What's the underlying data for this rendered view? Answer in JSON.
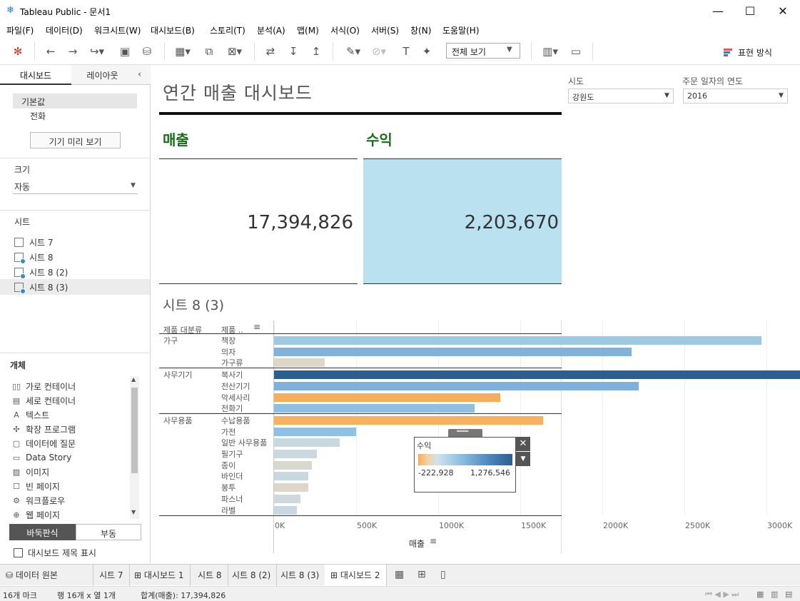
{
  "window": {
    "title": "Tableau Public - 문서1",
    "minimize": "—",
    "maximize": "☐",
    "close": "✕"
  },
  "menu": [
    "파일(F)",
    "데이터(D)",
    "워크시트(W)",
    "대시보드(B)",
    "스토리(T)",
    "분석(A)",
    "맵(M)",
    "서식(O)",
    "서버(S)",
    "창(N)",
    "도움말(H)"
  ],
  "toolbar": {
    "view_select": "전체 보기",
    "show_me": "표현 방식"
  },
  "left_pane": {
    "tabs": [
      "대시보드",
      "레이아웃"
    ],
    "device": {
      "default": "기본값",
      "phone": "전화",
      "preview_button": "기기 미리 보기"
    },
    "size": {
      "label": "크기",
      "value": "자동"
    },
    "sheets": {
      "label": "시트",
      "items": [
        "시트 7",
        "시트 8",
        "시트 8 (2)",
        "시트 8 (3)"
      ]
    },
    "objects": {
      "label": "개체",
      "items": [
        "가로 컨테이너",
        "세로 컨테이너",
        "텍스트",
        "확장 프로그램",
        "데이터에 질문",
        "Data Story",
        "이미지",
        "빈 페이지",
        "워크플로우",
        "웹 페이지"
      ],
      "tiled": "바둑판식",
      "floating": "부동",
      "show_title": "대시보드 제목 표시"
    }
  },
  "dashboard": {
    "title": "연간 매출 대시보드",
    "kpi_sales": {
      "label": "매출",
      "value": "17,394,826"
    },
    "kpi_profit": {
      "label": "수익",
      "value": "2,203,670"
    },
    "filters": {
      "region": {
        "label": "시도",
        "value": "강원도"
      },
      "year": {
        "label": "주문 일자의 연도",
        "value": "2016"
      }
    },
    "sheet_title": "시트 8 (3)",
    "col_headers": [
      "제품 대분류",
      "제품 .."
    ],
    "x_axis_label": "매출",
    "legend": {
      "title": "수익",
      "min": "-222,928",
      "max": "1,276,546"
    }
  },
  "chart_data": {
    "type": "bar",
    "orientation": "horizontal",
    "xlabel": "매출",
    "xlim": [
      0,
      3500000
    ],
    "x_ticks": [
      "0K",
      "500K",
      "1000K",
      "1500K",
      "2000K",
      "2500K",
      "3000K"
    ],
    "groups": [
      {
        "name": "가구",
        "items": [
          {
            "label": "책장",
            "value": 2970000,
            "color": "#9ecae1"
          },
          {
            "label": "의자",
            "value": 2180000,
            "color": "#80b3da"
          },
          {
            "label": "가구류",
            "value": 310000,
            "color": "#ddd6c9"
          }
        ]
      },
      {
        "name": "사무기기",
        "items": [
          {
            "label": "복사기",
            "value": 3320000,
            "color": "#2b5f91"
          },
          {
            "label": "전산기기",
            "value": 2220000,
            "color": "#7fb1da"
          },
          {
            "label": "악세사리",
            "value": 1380000,
            "color": "#f6ad5c"
          },
          {
            "label": "전화기",
            "value": 1220000,
            "color": "#8fc0e2"
          }
        ]
      },
      {
        "name": "사무용품",
        "items": [
          {
            "label": "수납용품",
            "value": 1640000,
            "color": "#f8b15f"
          },
          {
            "label": "가전",
            "value": 500000,
            "color": "#8ec1e3"
          },
          {
            "label": "일반 사무용품",
            "value": 400000,
            "color": "#c8d8e0"
          },
          {
            "label": "필기구",
            "value": 260000,
            "color": "#c9d9df"
          },
          {
            "label": "종이",
            "value": 230000,
            "color": "#d8d8cf"
          },
          {
            "label": "바인더",
            "value": 210000,
            "color": "#c8d8e0"
          },
          {
            "label": "봉투",
            "value": 210000,
            "color": "#ddd6c9"
          },
          {
            "label": "파스너",
            "value": 160000,
            "color": "#cfd8dc"
          },
          {
            "label": "라벨",
            "value": 140000,
            "color": "#c8d8e0"
          }
        ]
      }
    ]
  },
  "bottom_tabs": [
    "데이터 원본",
    "시트 7",
    "대시보드 1",
    "시트 8",
    "시트 8 (2)",
    "시트 8 (3)",
    "대시보드 2"
  ],
  "status": {
    "marks": "16개 마크",
    "rows_cols": "행 16개  x  열 1개",
    "sum": "합계(매출): 17,394,826"
  },
  "colors": {
    "kpi_label": "#1a6b1a",
    "profit_bg": "#b9e1f0",
    "legend_low": "#f6ad5c",
    "legend_high": "#2b5f91"
  }
}
